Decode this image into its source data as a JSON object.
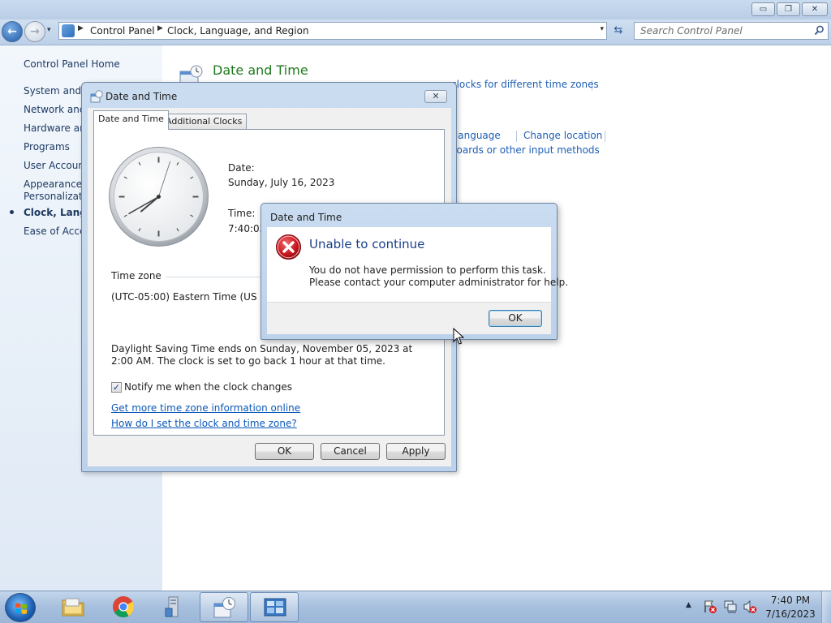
{
  "explorer": {
    "caption_buttons": {
      "minimize": "▭",
      "maximize": "❐",
      "close": "✕"
    },
    "nav": {
      "back": "←",
      "forward": "→",
      "recent": "▾"
    },
    "breadcrumb": [
      "Control Panel",
      "Clock, Language, and Region"
    ],
    "address_dropdown": "▾",
    "refresh": "⇆",
    "search_placeholder": "Search Control Panel"
  },
  "sidebar": {
    "home": "Control Panel Home",
    "items": [
      "System and S",
      "Network and",
      "Hardware and",
      "Programs",
      "User Account",
      "Appearance a\nPersonalizati",
      "Clock, Langua",
      "Ease of Acces"
    ],
    "active_index": 6
  },
  "content": {
    "heading": "Date and Time",
    "links": [
      "clocks for different time zones",
      "y language",
      "Change location",
      "rboards or other input methods"
    ]
  },
  "datetime_dialog": {
    "title": "Date and Time",
    "close": "✕",
    "tabs": [
      "Date and Time",
      "Additional Clocks"
    ],
    "active_tab": 0,
    "clock_time": "7:40:03",
    "date_label": "Date:",
    "date_value": "Sunday, July 16, 2023",
    "time_label": "Time:",
    "time_value": "7:40:03 I",
    "timezone_group": "Time zone",
    "timezone_value": "(UTC-05:00) Eastern Time (US & Ca",
    "dst_text": "Daylight Saving Time ends on Sunday, November 05, 2023 at 2:00 AM. The clock is set to go back 1 hour at that time.",
    "notify_label": "Notify me when the clock changes",
    "notify_checked": true,
    "checkmark": "✓",
    "links": [
      "Get more time zone information online",
      "How do I set the clock and time zone?"
    ],
    "buttons": {
      "ok": "OK",
      "cancel": "Cancel",
      "apply": "Apply"
    }
  },
  "error_dialog": {
    "title": "Date and Time",
    "heading": "Unable to continue",
    "message": "You do not have permission to perform this task.\nPlease contact your computer administrator for help.",
    "ok": "OK",
    "icon": "error-icon"
  },
  "taskbar": {
    "items": [
      "windows-explorer",
      "google-chrome",
      "server-manager",
      "date-and-time",
      "control-panel"
    ],
    "active_items": [
      3,
      4
    ],
    "tray_up": "▲",
    "tray_icons": [
      "action-center-icon",
      "network-icon",
      "volume-muted-icon"
    ],
    "time": "7:40 PM",
    "date": "7/16/2023"
  },
  "colors": {
    "link": "#1d5fb5",
    "heading_green": "#1e7a1e",
    "error_heading": "#1a3e8c",
    "error_red": "#c8141e"
  }
}
